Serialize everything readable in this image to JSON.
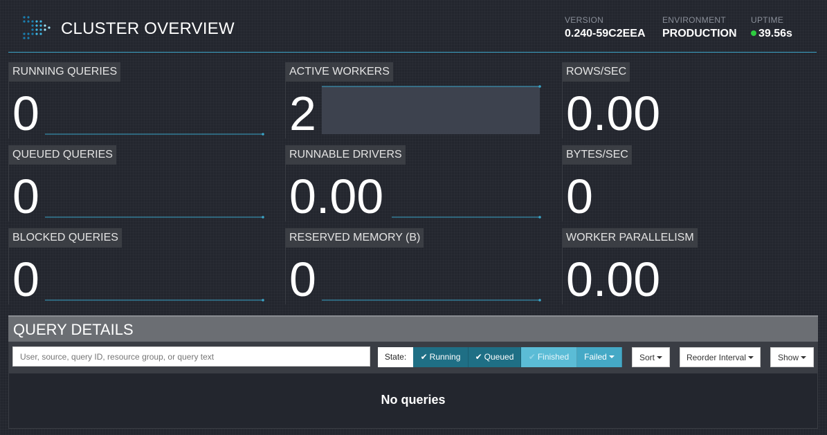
{
  "header": {
    "title": "CLUSTER OVERVIEW",
    "version_label": "VERSION",
    "version_value": "0.240-59C2EEA",
    "environment_label": "ENVIRONMENT",
    "environment_value": "PRODUCTION",
    "uptime_label": "UPTIME",
    "uptime_value": "39.56s",
    "uptime_status_color": "#2ecc40",
    "accent_color": "#3aa6c9"
  },
  "metrics": [
    {
      "label": "RUNNING QUERIES",
      "value": "0"
    },
    {
      "label": "ACTIVE WORKERS",
      "value": "2"
    },
    {
      "label": "ROWS/SEC",
      "value": "0.00"
    },
    {
      "label": "QUEUED QUERIES",
      "value": "0"
    },
    {
      "label": "RUNNABLE DRIVERS",
      "value": "0.00"
    },
    {
      "label": "BYTES/SEC",
      "value": "0"
    },
    {
      "label": "BLOCKED QUERIES",
      "value": "0"
    },
    {
      "label": "RESERVED MEMORY (B)",
      "value": "0"
    },
    {
      "label": "WORKER PARALLELISM",
      "value": "0.00"
    }
  ],
  "query_details": {
    "title": "QUERY DETAILS",
    "search_placeholder": "User, source, query ID, resource group, or query text",
    "state_label": "State:",
    "state_buttons": {
      "running": "Running",
      "queued": "Queued",
      "finished": "Finished",
      "failed": "Failed"
    },
    "sort_label": "Sort",
    "reorder_label": "Reorder Interval",
    "show_label": "Show",
    "empty_message": "No queries"
  }
}
